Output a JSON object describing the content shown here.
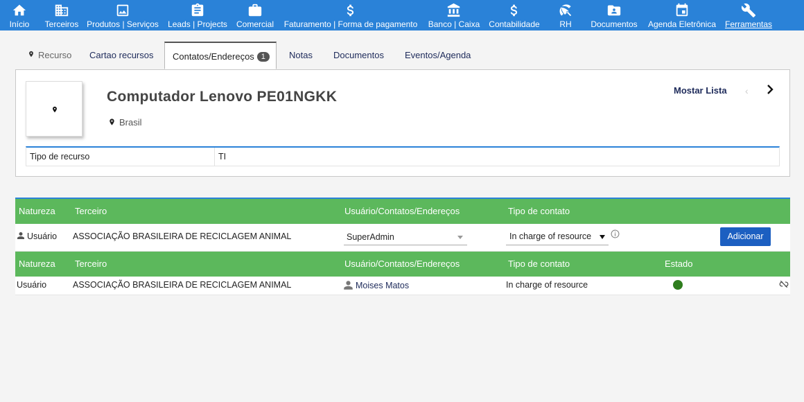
{
  "nav": {
    "items": [
      {
        "label": "Início",
        "icon": "home-icon"
      },
      {
        "label": "Terceiros",
        "icon": "building-icon"
      },
      {
        "label": "Produtos | Serviços",
        "icon": "image-icon"
      },
      {
        "label": "Leads | Projects",
        "icon": "clipboard-icon"
      },
      {
        "label": "Comercial",
        "icon": "briefcase-icon"
      },
      {
        "label": "Faturamento | Forma de pagamento",
        "icon": "dollar-icon"
      },
      {
        "label": "Banco | Caixa",
        "icon": "bank-icon"
      },
      {
        "label": "Contabilidade",
        "icon": "dollar-icon"
      },
      {
        "label": "RH",
        "icon": "umbrella-icon"
      },
      {
        "label": "Documentos",
        "icon": "folder-icon"
      },
      {
        "label": "Agenda Eletrônica",
        "icon": "calendar-icon"
      },
      {
        "label": "Ferramentas",
        "icon": "wrench-icon"
      }
    ]
  },
  "tabs": {
    "resource": "Recurso",
    "cartao": "Cartao recursos",
    "contatos": "Contatos/Endereços",
    "contatos_count": "1",
    "notas": "Notas",
    "documentos": "Documentos",
    "eventos": "Eventos/Agenda"
  },
  "card": {
    "title": "Computador Lenovo PE01NGKK",
    "country": "Brasil",
    "show_list": "Mostar Lista",
    "prev": "‹",
    "attr_label": "Tipo de recurso",
    "attr_value": "TI"
  },
  "add_table": {
    "headers": [
      "Natureza",
      "Terceiro",
      "Usuário/Contatos/Endereços",
      "Tipo de contato"
    ],
    "nature": "Usuário",
    "thirdparty": "ASSOCIAÇÃO BRASILEIRA DE RECICLAGEM ANIMAL",
    "user_value": "SuperAdmin",
    "contact_type_value": "In charge of resource",
    "add_button": "Adicionar"
  },
  "list_table": {
    "headers": [
      "Natureza",
      "Terceiro",
      "Usuário/Contatos/Endereços",
      "Tipo de contato",
      "Estado"
    ],
    "rows": [
      {
        "nature": "Usuário",
        "thirdparty": "ASSOCIAÇÃO BRASILEIRA DE RECICLAGEM ANIMAL",
        "user": "Moises Matos",
        "contact_type": "In charge of resource",
        "status_color": "#2e7d1e"
      }
    ]
  },
  "colors": {
    "nav_bg": "#2a82d8",
    "table_header": "#5cb85c",
    "button": "#1c5fc1"
  }
}
